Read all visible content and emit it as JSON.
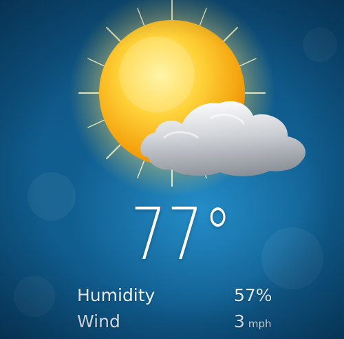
{
  "weather": {
    "condition_icon": "partly-sunny-icon",
    "temperature": "77°",
    "details": [
      {
        "label": "Humidity",
        "value": "57%",
        "unit": ""
      },
      {
        "label": "Wind",
        "value": "3",
        "unit": "mph"
      }
    ]
  },
  "colors": {
    "background": "#0f5b8b",
    "sun": "#ffc21a",
    "cloud": "#c8ccd3",
    "text": "#ffffff"
  }
}
